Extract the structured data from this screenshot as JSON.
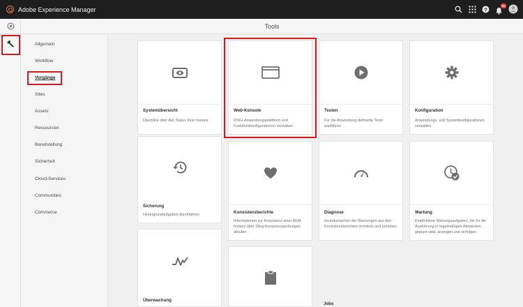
{
  "app": {
    "brand": "Adobe Experience Manager",
    "notification_count": "30"
  },
  "header": {
    "title": "Tools"
  },
  "icons": {
    "search": "search-icon",
    "apps": "apps-grid-icon",
    "help": "help-icon",
    "bell": "bell-icon",
    "avatar": "avatar-icon",
    "compass": "navigation-icon",
    "hammer": "hammer-icon"
  },
  "nav": {
    "items": [
      {
        "label": "Allgemein"
      },
      {
        "label": "Workflow"
      },
      {
        "label": "Vorgänge"
      },
      {
        "label": "Sites"
      },
      {
        "label": "Assets"
      },
      {
        "label": "Ressourcen"
      },
      {
        "label": "Bereitstellung"
      },
      {
        "label": "Sicherheit"
      },
      {
        "label": "Cloud-Services"
      },
      {
        "label": "Communities"
      },
      {
        "label": "Commerce"
      }
    ],
    "active": "Vorgänge"
  },
  "cards": [
    {
      "title": "Systemübersicht",
      "desc": "Überblick über den Status Ihrer Instanz",
      "icon": "dashboard-icon"
    },
    {
      "title": "Web-Konsole",
      "desc": "OSGi-Anwendungsplattform und Funktionskonfigurationen verwalten",
      "icon": "browser-window-icon"
    },
    {
      "title": "Testen",
      "desc": "Für die Anwendung definierte Tests ausführen",
      "icon": "play-icon"
    },
    {
      "title": "Konfiguration",
      "desc": "Anwendungs- und Systemkonfigurationen verwalten",
      "icon": "gear-icon"
    },
    {
      "title": "Sicherung",
      "desc": "Hintergrundaufgaben durchführen",
      "icon": "history-icon"
    },
    {
      "title": "Konsistenzberichte",
      "desc": "Informationen zur Konsistenz einer AEM-Instanz über Sling-Konsistenzprüfungen abrufen",
      "icon": "heart-icon"
    },
    {
      "title": "Diagnose",
      "desc": "Grundursachen der Warnungen aus den Konsistenzberichten ermitteln und beheben",
      "icon": "gauge-icon"
    },
    {
      "title": "Wartung",
      "desc": "Empfohlene Wartungsaufgaben, die für die Ausführung in regelmäßigen Abständen geplant sind, anzeigen und verfolgen",
      "icon": "clock-check-icon"
    },
    {
      "title": "Überwachung",
      "desc": "",
      "icon": "pulse-icon"
    },
    {
      "title": "",
      "desc": "",
      "icon": "clipboard-icon"
    },
    {
      "title": "Jobs",
      "desc": "",
      "icon": ""
    }
  ],
  "colors": {
    "topbar": "#1e1e1e",
    "accent": "#e8743b",
    "highlight": "#d7191f",
    "icon": "#6e6e6e"
  }
}
